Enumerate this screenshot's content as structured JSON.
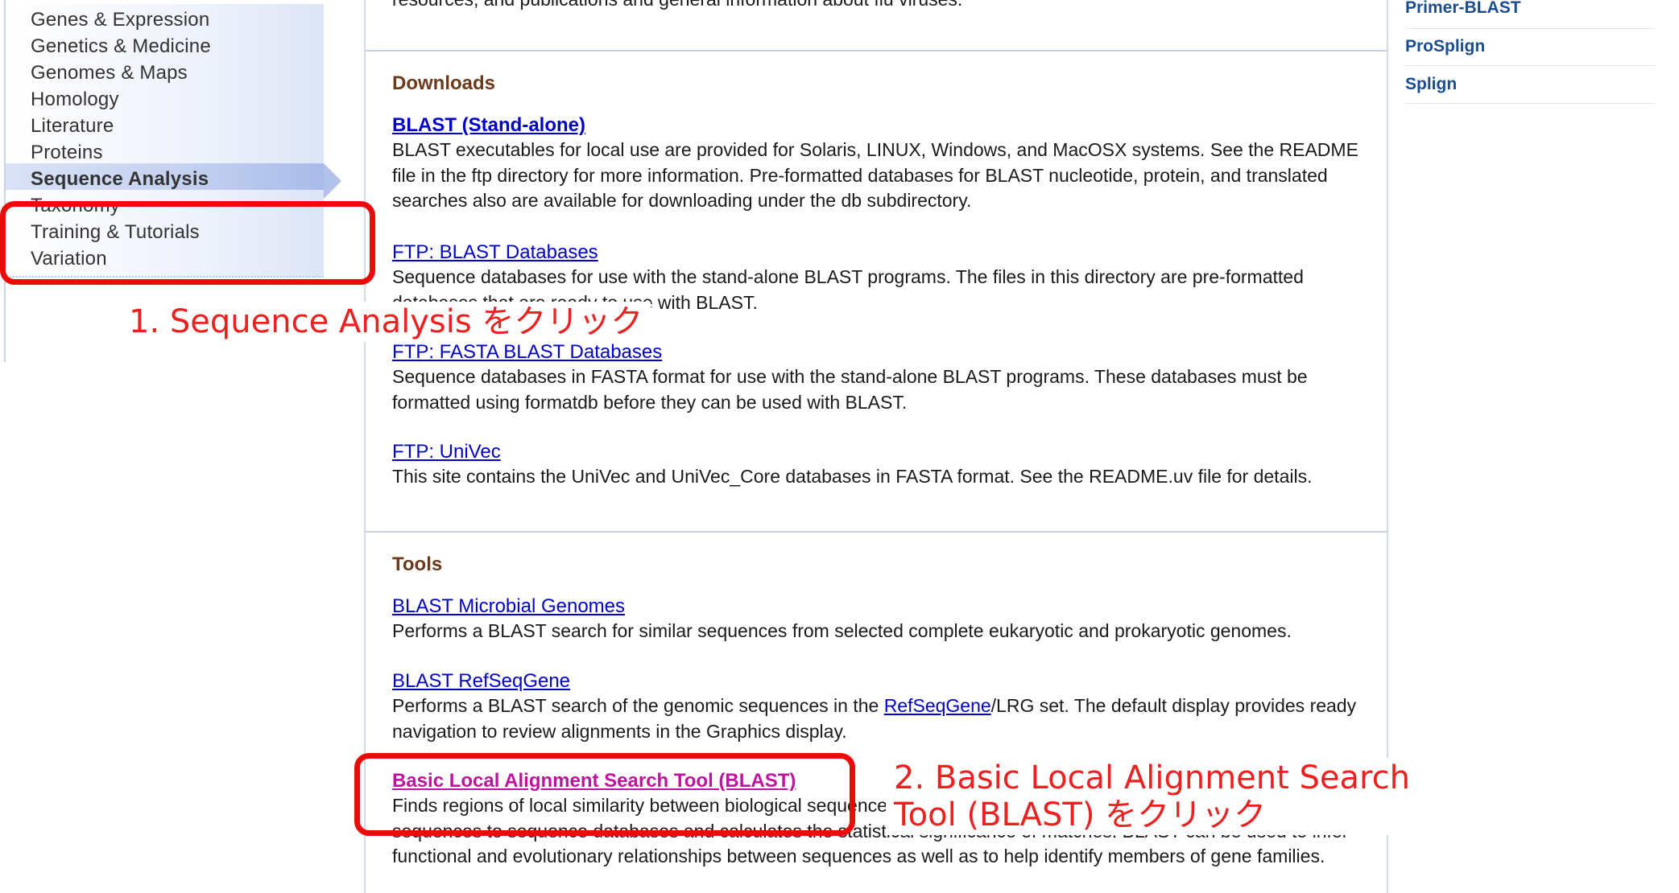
{
  "left_nav": {
    "items": [
      {
        "label": "Genes & Expression",
        "active": false
      },
      {
        "label": "Genetics & Medicine",
        "active": false
      },
      {
        "label": "Genomes & Maps",
        "active": false
      },
      {
        "label": "Homology",
        "active": false
      },
      {
        "label": "Literature",
        "active": false
      },
      {
        "label": "Proteins",
        "active": false
      },
      {
        "label": "Sequence Analysis",
        "active": true
      },
      {
        "label": "Taxonomy",
        "active": false
      },
      {
        "label": "Training & Tutorials",
        "active": false
      },
      {
        "label": "Variation",
        "active": false
      }
    ]
  },
  "main": {
    "top_fragment": "resources, and publications and general information about flu viruses.",
    "downloads": {
      "title": "Downloads",
      "entries": [
        {
          "link": "BLAST (Stand-alone)",
          "desc": "BLAST executables for local use are provided for Solaris, LINUX, Windows, and MacOSX systems. See the README file in the ftp directory for more information. Pre-formatted databases for BLAST nucleotide, protein, and translated searches also are available for downloading under the db subdirectory."
        },
        {
          "link": "FTP: BLAST Databases",
          "desc": "Sequence databases for use with the stand-alone BLAST programs. The files in this directory are pre-formatted databases that are ready to use with BLAST."
        },
        {
          "link": "FTP: FASTA BLAST Databases",
          "desc": "Sequence databases in FASTA format for use with the stand-alone BLAST programs. These databases must be formatted using formatdb before they can be used with BLAST."
        },
        {
          "link": "FTP: UniVec",
          "desc": "This site contains the UniVec and UniVec_Core databases in FASTA format. See the README.uv file for details."
        }
      ]
    },
    "tools": {
      "title": "Tools",
      "entries": [
        {
          "link": "BLAST Microbial Genomes",
          "desc": "Performs a BLAST search for similar sequences from selected complete eukaryotic and prokaryotic genomes."
        },
        {
          "link": "BLAST RefSeqGene",
          "desc_before": "Performs a BLAST search of the genomic sequences in the ",
          "desc_link": "RefSeqGene",
          "desc_after": "/LRG set. The default display provides ready navigation to review alignments in the Graphics display."
        },
        {
          "link": "Basic Local Alignment Search Tool (BLAST)",
          "desc": "Finds regions of local similarity between biological sequences. The program compares nucleotide or protein sequences to sequence databases and calculates the statistical significance of matches. BLAST can be used to infer functional and evolutionary relationships between sequences as well as to help identify members of gene families."
        }
      ]
    }
  },
  "right_links": [
    "Primer-BLAST",
    "ProSplign",
    "Splign"
  ],
  "annotations": {
    "step1": "1. Sequence Analysis をクリック",
    "step2_line1": "2. Basic Local Alignment Search",
    "step2_line2": "Tool (BLAST) をクリック",
    "color": "#ee0a0a"
  }
}
